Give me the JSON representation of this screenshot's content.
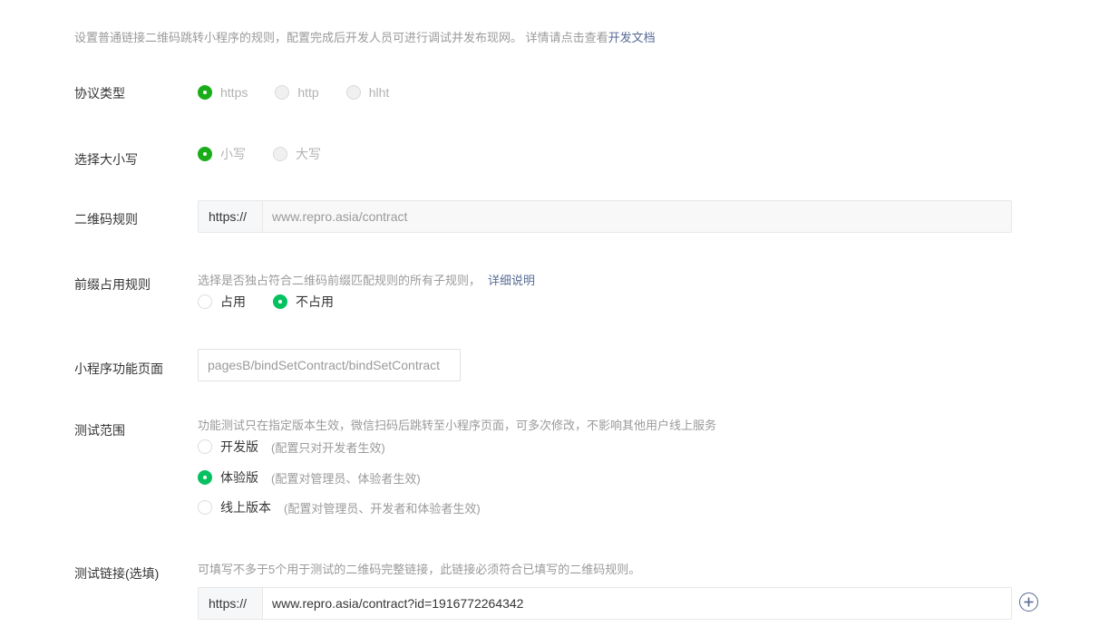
{
  "intro": {
    "text": "设置普通链接二维码跳转小程序的规则，配置完成后开发人员可进行调试并发布现网。 详情请点击查看",
    "link": "开发文档"
  },
  "protocol": {
    "label": "协议类型",
    "options": [
      "https",
      "http",
      "hlht"
    ],
    "selected": "https"
  },
  "case": {
    "label": "选择大小写",
    "options": [
      "小写",
      "大写"
    ],
    "selected": "小写"
  },
  "qr_rule": {
    "label": "二维码规则",
    "prefix": "https://",
    "value": "www.repro.asia/contract"
  },
  "prefix_rule": {
    "label": "前缀占用规则",
    "desc": "选择是否独占符合二维码前缀匹配规则的所有子规则，",
    "link": "详细说明",
    "options": [
      "占用",
      "不占用"
    ],
    "selected": "不占用"
  },
  "mini_page": {
    "label": "小程序功能页面",
    "value": "pagesB/bindSetContract/bindSetContract"
  },
  "test_scope": {
    "label": "测试范围",
    "desc": "功能测试只在指定版本生效，微信扫码后跳转至小程序页面，可多次修改，不影响其他用户线上服务",
    "options": [
      {
        "label": "开发版",
        "hint": "(配置只对开发者生效)"
      },
      {
        "label": "体验版",
        "hint": "(配置对管理员、体验者生效)"
      },
      {
        "label": "线上版本",
        "hint": "(配置对管理员、开发者和体验者生效)"
      }
    ],
    "selected": "体验版"
  },
  "test_link": {
    "label": "测试链接(选填)",
    "desc": "可填写不多于5个用于测试的二维码完整链接，此链接必须符合已填写的二维码规则。",
    "prefix": "https://",
    "value": "www.repro.asia/contract?id=1916772264342"
  },
  "icons": {
    "add": "plus-circle-icon"
  },
  "colors": {
    "accent_green": "#1aad19",
    "bright_green": "#07c160",
    "link_blue": "#576b95"
  }
}
